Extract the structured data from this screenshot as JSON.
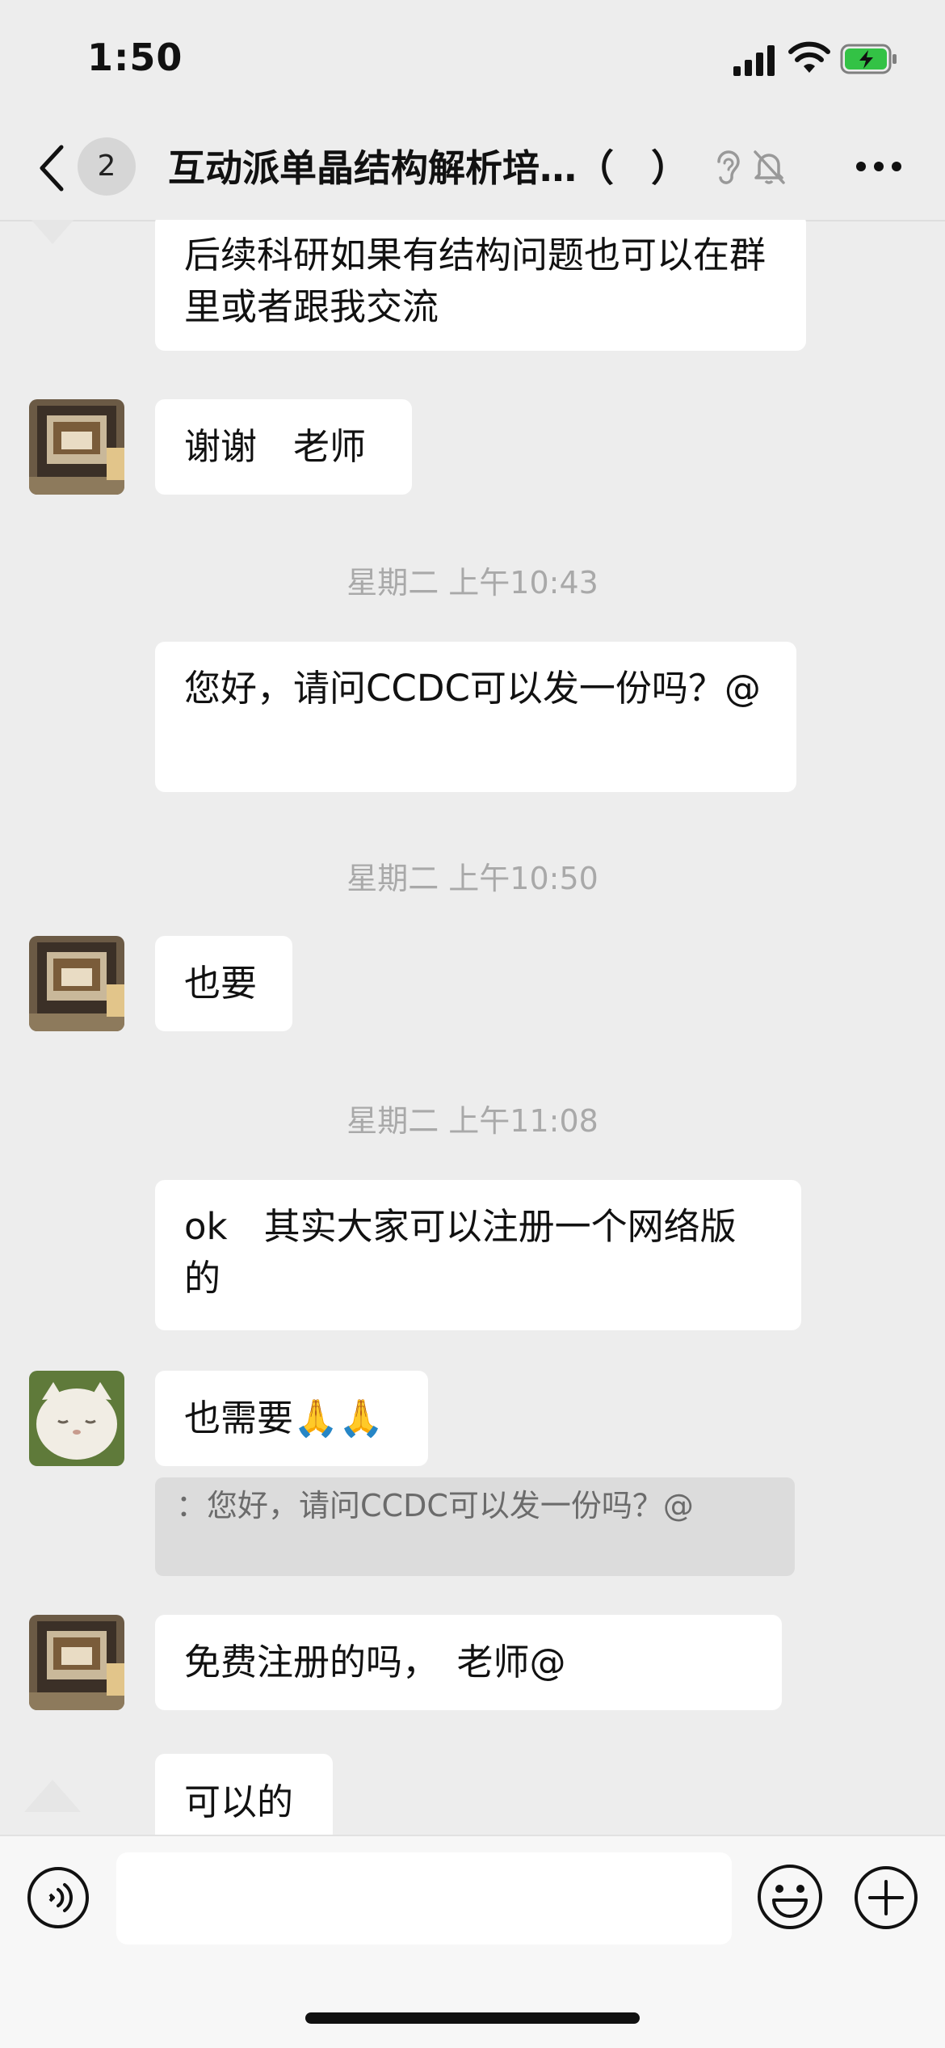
{
  "status": {
    "time": "1:50"
  },
  "nav": {
    "unread_count": "2",
    "title": "互动派单晶结构解析培…（　）"
  },
  "messages": [
    {
      "text": "后续科研如果有结构问题也可以在群里或者跟我交流"
    },
    {
      "text": "谢谢　老师"
    },
    {
      "timestamp": "星期二 上午10:43"
    },
    {
      "text": "您好，请问CCDC可以发一份吗？@"
    },
    {
      "timestamp": "星期二 上午10:50"
    },
    {
      "text": "也要"
    },
    {
      "timestamp": "星期二 上午11:08"
    },
    {
      "text": "ok　其实大家可以注册一个网络版的"
    },
    {
      "text": "也需要🙏🙏"
    },
    {
      "quote": "：您好，请问CCDC可以发一份吗？@"
    },
    {
      "text": "免费注册的吗，　老师@"
    },
    {
      "text": "可以的"
    }
  ],
  "colors": {
    "background": "#ededed",
    "bubble": "#ffffff",
    "quote": "#dcdcdc",
    "battery": "#33c245"
  },
  "icons": [
    "back-chevron-icon",
    "ear-icon",
    "mute-bell-icon",
    "more-icon",
    "voice-icon",
    "emoji-icon",
    "plus-icon",
    "signal-icon",
    "wifi-icon",
    "battery-icon"
  ]
}
